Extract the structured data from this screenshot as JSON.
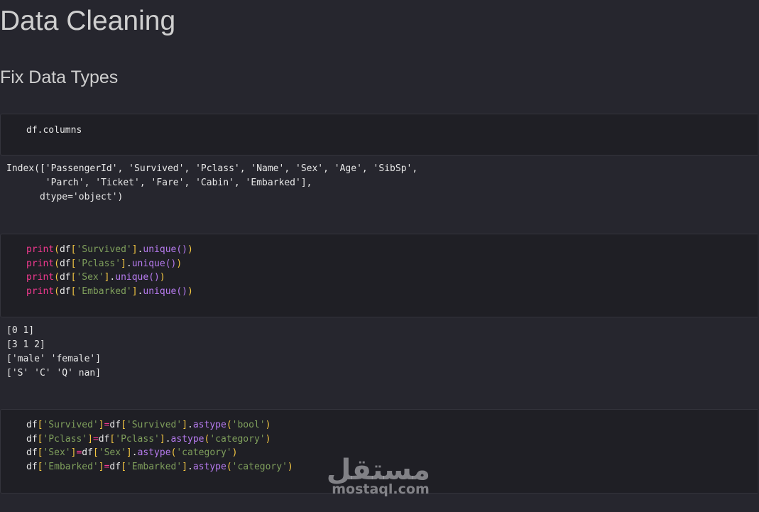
{
  "page": {
    "title": "Data Cleaning",
    "subtitle": "Fix Data Types"
  },
  "cell1": {
    "code": "df.columns",
    "output_lines": [
      "Index(['PassengerId', 'Survived', 'Pclass', 'Name', 'Sex', 'Age', 'SibSp',",
      "       'Parch', 'Ticket', 'Fare', 'Cabin', 'Embarked'],",
      "      dtype='object')"
    ]
  },
  "cell2": {
    "lines": [
      {
        "fn": "print",
        "var": "df",
        "col": "'Survived'",
        "method": "unique"
      },
      {
        "fn": "print",
        "var": "df",
        "col": "'Pclass'",
        "method": "unique"
      },
      {
        "fn": "print",
        "var": "df",
        "col": "'Sex'",
        "method": "unique"
      },
      {
        "fn": "print",
        "var": "df",
        "col": "'Embarked'",
        "method": "unique"
      }
    ],
    "output_lines": [
      "[0 1]",
      "[3 1 2]",
      "['male' 'female']",
      "['S' 'C' 'Q' nan]"
    ]
  },
  "cell3": {
    "lines": [
      {
        "var": "df",
        "col": "'Survived'",
        "method": "astype",
        "arg": "'bool'"
      },
      {
        "var": "df",
        "col": "'Pclass'",
        "method": "astype",
        "arg": "'category'"
      },
      {
        "var": "df",
        "col": "'Sex'",
        "method": "astype",
        "arg": "'category'"
      },
      {
        "var": "df",
        "col": "'Embarked'",
        "method": "astype",
        "arg": "'category'"
      }
    ]
  },
  "watermark": {
    "arabic": "مستقل",
    "latin": "mostaql.com"
  },
  "colors": {
    "background": "#26262e",
    "cell_background": "#1f1f25",
    "keyword": "#f2398f",
    "string": "#7f9f5c",
    "bracket": "#f5c842",
    "method": "#b77bf0"
  }
}
